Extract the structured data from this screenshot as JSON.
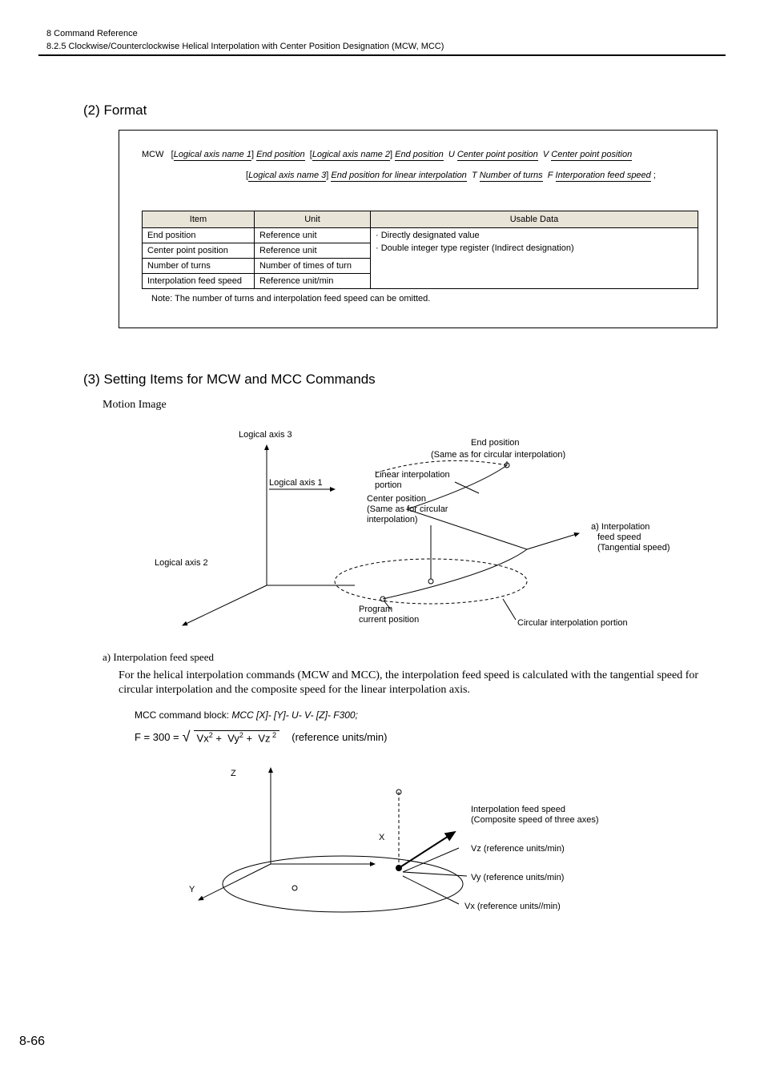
{
  "header": {
    "chapter": "8  Command Reference",
    "section": "8.2.5  Clockwise/Counterclockwise Helical Interpolation with Center Position Designation (MCW, MCC)"
  },
  "s2": {
    "title": "(2) Format",
    "cmd": "MCW",
    "line1_parts": {
      "p1": "Logical axis name 1",
      "v1": "End position",
      "p2": "Logical axis name 2",
      "v2": "End position",
      "p3": "U",
      "v3": "Center point position",
      "p4": "V",
      "v4": "Center point position"
    },
    "line2_parts": {
      "p1": "Logical axis name 3",
      "v1": "End position for linear interpolation",
      "p2": "T",
      "v2": "Number of turns",
      "p3": "F",
      "v3": "Interporation feed speed"
    },
    "table": {
      "headers": {
        "item": "Item",
        "unit": "Unit",
        "usable": "Usable Data"
      },
      "r1": {
        "item": "End position",
        "unit": "Reference unit"
      },
      "r2": {
        "item": "Center point position",
        "unit": "Reference unit"
      },
      "r3": {
        "item": "Number of turns",
        "unit": "Number of times of turn"
      },
      "r4": {
        "item": "Interpolation feed speed",
        "unit": "Reference unit/min"
      },
      "usable1": "· Directly designated value",
      "usable2": "· Double integer type register (Indirect designation)"
    },
    "note": "Note: The number of turns and interpolation feed speed can be omitted."
  },
  "s3": {
    "title": "(3) Setting Items for MCW and MCC Commands",
    "sub": "Motion Image",
    "fig": {
      "axis3": "Logical axis 3",
      "axis1": "Logical axis 1",
      "axis2": "Logical axis 2",
      "end1": "End position",
      "end2": "(Same as for circular interpolation)",
      "lin1": "Linear interpolation",
      "lin2": "portion",
      "ctr1": "Center position",
      "ctr2": "(Same as for circular",
      "ctr3": "interpolation)",
      "feed1": "a) Interpolation",
      "feed2": "feed speed",
      "feed3": "(Tangential speed)",
      "prog1": "Program",
      "prog2": "current position",
      "circ": "Circular interpolation portion"
    },
    "a_title": "a) Interpolation feed speed",
    "a_body": "For the helical interpolation commands (MCW and MCC), the interpolation feed speed is calculated with the tangential speed for circular interpolation and the composite speed for the linear interpolation axis.",
    "cmd_block_label": "MCC command block:",
    "cmd_block_val": "MCC [X]- [Y]- U- V- [Z]- F300;",
    "formula": {
      "lhs": "F = 300 =",
      "vx": "Vx",
      "vy": "Vy",
      "vz": "Vz",
      "units": "(reference units/min)"
    },
    "fig2": {
      "z": "Z",
      "x": "X",
      "y": "Y",
      "comp1": "Interpolation feed speed",
      "comp2": "(Composite speed of three axes)",
      "vz": "Vz (reference units/min)",
      "vy": "Vy (reference units/min)",
      "vx": "Vx (reference units//min)"
    }
  },
  "page": "8-66"
}
